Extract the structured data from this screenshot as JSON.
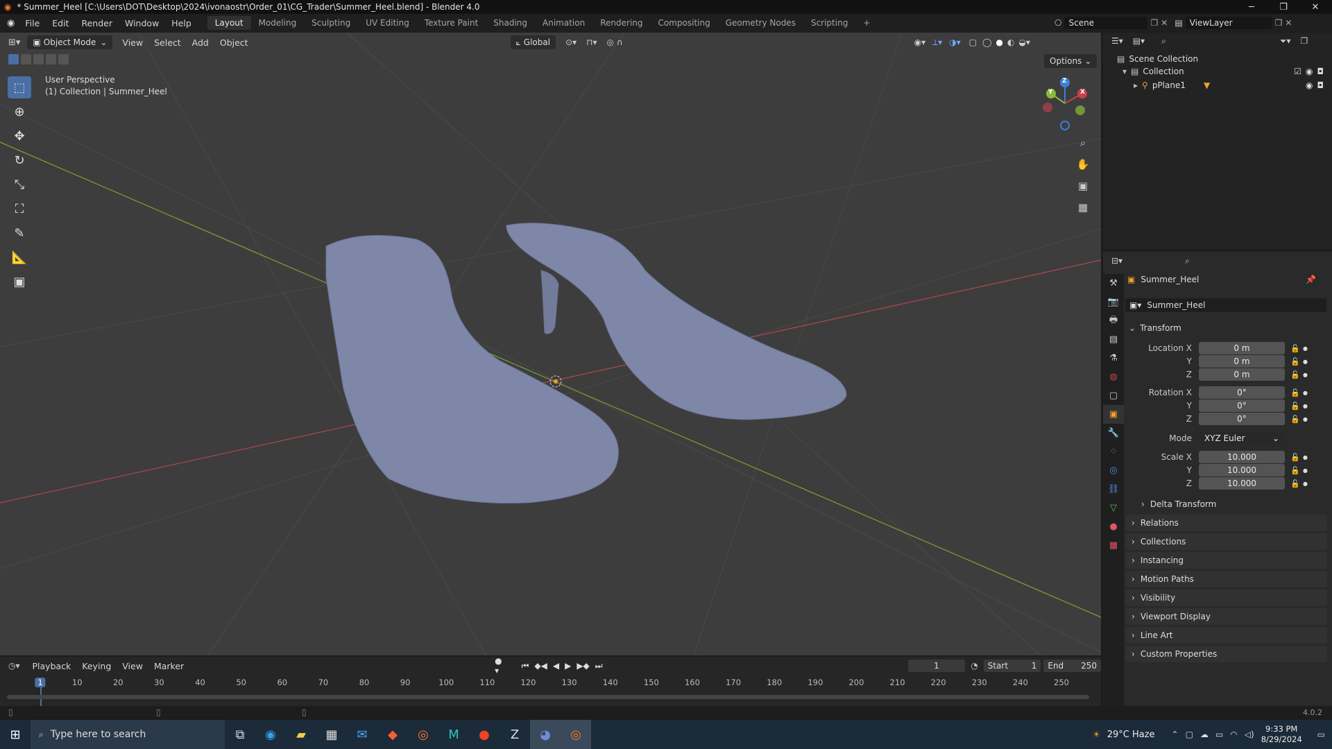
{
  "window": {
    "title": "* Summer_Heel [C:\\Users\\DOT\\Desktop\\2024\\ivonaostr\\Order_01\\CG_Trader\\Summer_Heel.blend] - Blender 4.0",
    "minimize": "─",
    "maximize": "❐",
    "close": "✕"
  },
  "menu": [
    "File",
    "Edit",
    "Render",
    "Window",
    "Help"
  ],
  "workspaces": [
    "Layout",
    "Modeling",
    "Sculpting",
    "UV Editing",
    "Texture Paint",
    "Shading",
    "Animation",
    "Rendering",
    "Compositing",
    "Geometry Nodes",
    "Scripting"
  ],
  "workspace_add": "+",
  "scene": "Scene",
  "view_layer": "ViewLayer",
  "viewport_header": {
    "mode": "Object Mode",
    "menus": [
      "View",
      "Select",
      "Add",
      "Object"
    ],
    "orientation": "Global",
    "options": "Options"
  },
  "viewport": {
    "perspective": "User Perspective",
    "collection_info": "(1) Collection | Summer_Heel",
    "gizmo_x": "X",
    "gizmo_y": "Y",
    "gizmo_z": "Z"
  },
  "outliner": {
    "items": [
      "Scene Collection",
      "Collection",
      "pPlane1"
    ]
  },
  "properties": {
    "object_name": "Summer_Heel",
    "data_name": "Summer_Heel",
    "transform_header": "Transform",
    "location_label": "Location X",
    "loc": [
      "0 m",
      "0 m",
      "0 m"
    ],
    "rotation_label": "Rotation X",
    "rot": [
      "0°",
      "0°",
      "0°"
    ],
    "mode_label": "Mode",
    "mode_value": "XYZ Euler",
    "scale_label": "Scale X",
    "scale": [
      "10.000",
      "10.000",
      "10.000"
    ],
    "axis_y": "Y",
    "axis_z": "Z",
    "delta": "Delta Transform",
    "panels": [
      "Relations",
      "Collections",
      "Instancing",
      "Motion Paths",
      "Visibility",
      "Viewport Display",
      "Line Art",
      "Custom Properties"
    ]
  },
  "timeline": {
    "menus": [
      "Playback",
      "Keying",
      "View",
      "Marker"
    ],
    "current_frame": "1",
    "start_label": "Start",
    "start": "1",
    "end_label": "End",
    "end": "250",
    "ticks": [
      "1",
      "10",
      "20",
      "30",
      "40",
      "50",
      "60",
      "70",
      "80",
      "90",
      "100",
      "110",
      "120",
      "130",
      "140",
      "150",
      "160",
      "170",
      "180",
      "190",
      "200",
      "210",
      "220",
      "230",
      "240",
      "250"
    ]
  },
  "version": "4.0.2",
  "taskbar": {
    "search_placeholder": "Type here to search",
    "weather": "29°C  Haze",
    "time": "9:33 PM",
    "date": "8/29/2024"
  },
  "colors": {
    "accent": "#4a6fa5",
    "mesh": "#7e87a8",
    "x_axis": "#c9414b",
    "y_axis": "#8bba3b",
    "z_axis": "#3b7fd8"
  }
}
